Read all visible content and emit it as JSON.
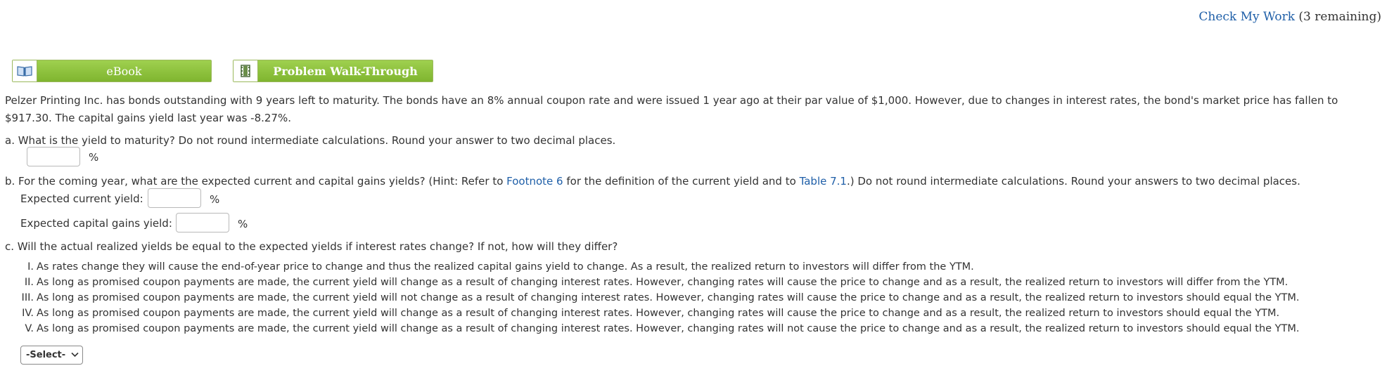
{
  "header": {
    "check_work_link": "Check My Work",
    "check_work_remaining": "(3 remaining)"
  },
  "toolbar": {
    "ebook_label": "eBook",
    "walkthrough_label": "Problem Walk-Through"
  },
  "problem": {
    "intro_line1": "Pelzer Printing Inc. has bonds outstanding with 9 years left to maturity. The bonds have an 8% annual coupon rate and were issued 1 year ago at their par value of $1,000. However, due to changes in interest rates, the bond's market price has fallen to",
    "intro_line2": "$917.30. The capital gains yield last year was -8.27%.",
    "part_a": {
      "question": "a. What is the yield to maturity? Do not round intermediate calculations. Round your answer to two decimal places.",
      "input_value": "",
      "unit": "%"
    },
    "part_b": {
      "question_pre": "b. For the coming year, what are the expected current and capital gains yields? (Hint: Refer to ",
      "footnote_link": "Footnote 6",
      "question_mid": " for the definition of the current yield and to ",
      "table_link": "Table 7.1",
      "question_post": ".) Do not round intermediate calculations. Round your answers to two decimal places.",
      "current_yield_label": "Expected current yield:",
      "current_yield_value": "",
      "capital_gains_label": "Expected capital gains yield:",
      "capital_gains_value": "",
      "unit": "%"
    },
    "part_c": {
      "question": "c. Will the actual realized yields be equal to the expected yields if interest rates change? If not, how will they differ?",
      "options": [
        {
          "num": "I.",
          "text": "As rates change they will cause the end-of-year price to change and thus the realized capital gains yield to change. As a result, the realized return to investors will differ from the YTM."
        },
        {
          "num": "II.",
          "text": "As long as promised coupon payments are made, the current yield will change as a result of changing interest rates. However, changing rates will cause the price to change and as a result, the realized return to investors will differ from the YTM."
        },
        {
          "num": "III.",
          "text": "As long as promised coupon payments are made, the current yield will not change as a result of changing interest rates. However, changing rates will cause the price to change and as a result, the realized return to investors should equal the YTM."
        },
        {
          "num": "IV.",
          "text": "As long as promised coupon payments are made, the current yield will change as a result of changing interest rates. However, changing rates will cause the price to change and as a result, the realized return to investors should equal the YTM."
        },
        {
          "num": "V.",
          "text": "As long as promised coupon payments are made, the current yield will change as a result of changing interest rates. However, changing rates will not cause the price to change and as a result, the realized return to investors should equal the YTM."
        }
      ],
      "select_value": "-Select-"
    }
  },
  "colors": {
    "link": "#1f5fa8",
    "button_green": "#8dc63f"
  }
}
